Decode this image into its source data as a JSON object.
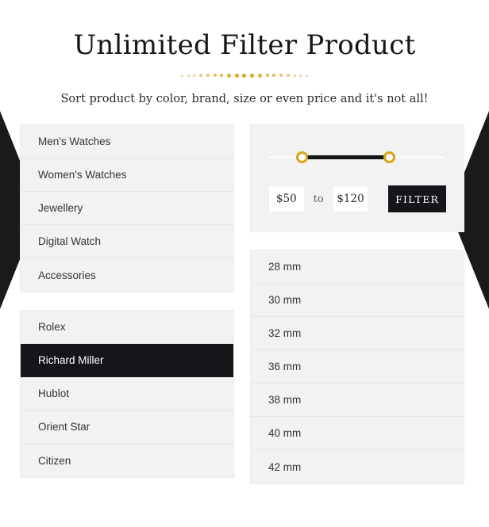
{
  "header": {
    "title": "Unlimited Filter Product",
    "subtitle": "Sort product by color, brand, size or even price and it's not all!",
    "separator": {
      "dot_count": 19,
      "edge_color": "#ecd9ae",
      "center_color": "#d9a513"
    }
  },
  "theme": {
    "accent_gold": "#d9a513",
    "dark": "#16161a",
    "panel_bg": "#f2f2f2",
    "divider": "#e6e6e6"
  },
  "categories": {
    "items": [
      {
        "label": "Men's Watches",
        "active": false
      },
      {
        "label": "Women's Watches",
        "active": false
      },
      {
        "label": "Jewellery",
        "active": false
      },
      {
        "label": "Digital Watch",
        "active": false
      },
      {
        "label": "Accessories",
        "active": false
      }
    ]
  },
  "brands": {
    "items": [
      {
        "label": "Rolex",
        "active": false
      },
      {
        "label": "Richard Miller",
        "active": true
      },
      {
        "label": "Hublot",
        "active": false
      },
      {
        "label": "Orient Star",
        "active": false
      },
      {
        "label": "Citizen",
        "active": false
      }
    ]
  },
  "price_filter": {
    "min_value": "$50",
    "max_value": "$120",
    "to_label": "to",
    "filter_label": "FILTER",
    "slider": {
      "handle_min_percent": 19,
      "handle_max_percent": 68
    }
  },
  "sizes": {
    "items": [
      {
        "label": "28 mm"
      },
      {
        "label": "30 mm"
      },
      {
        "label": "32 mm"
      },
      {
        "label": "36 mm"
      },
      {
        "label": "38 mm"
      },
      {
        "label": "40 mm"
      },
      {
        "label": "42 mm"
      }
    ]
  }
}
